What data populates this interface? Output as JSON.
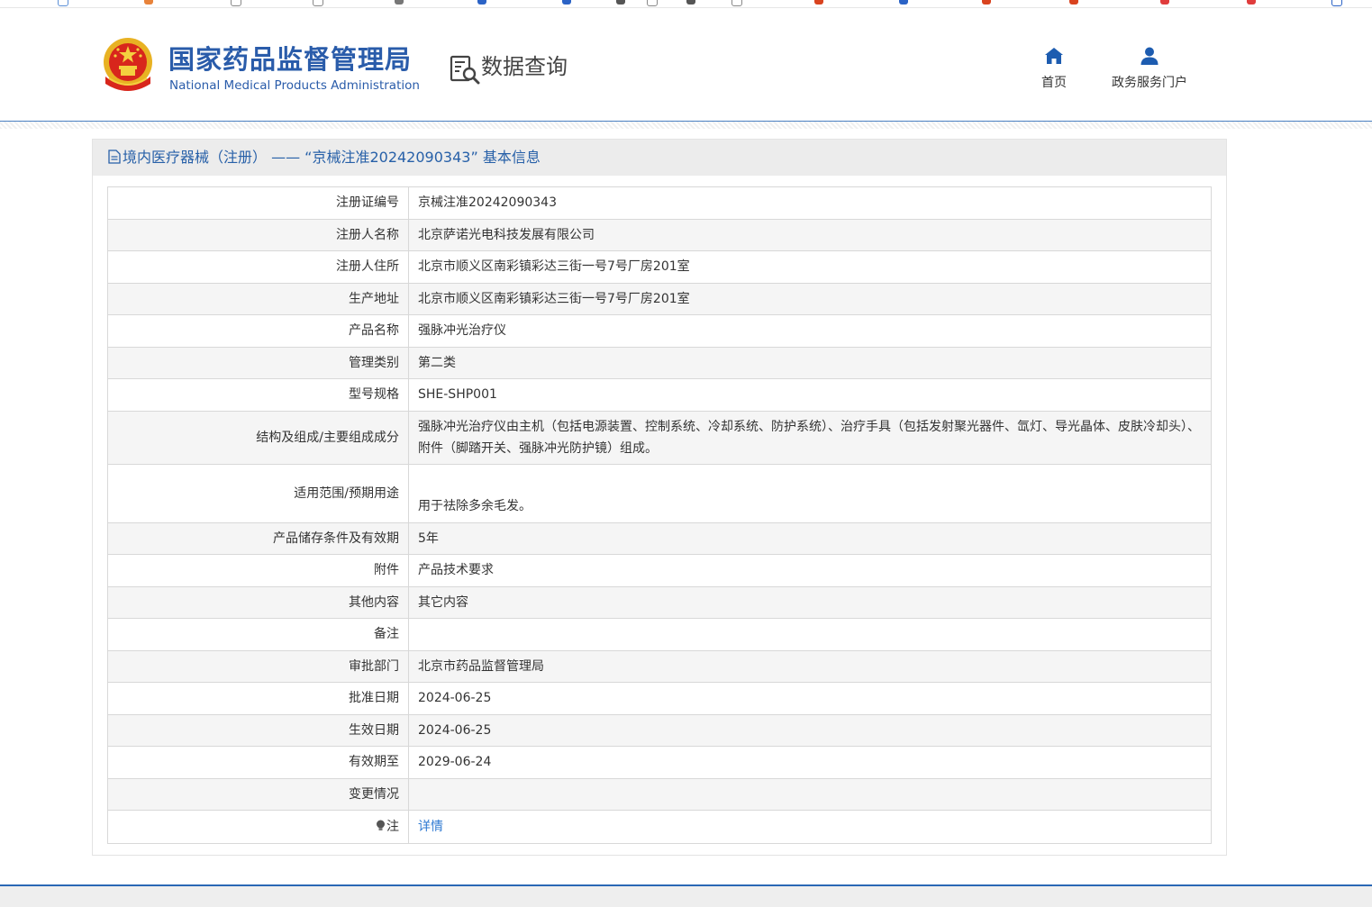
{
  "header": {
    "agency_name_cn": "国家药品监督管理局",
    "agency_name_en": "National Medical Products Administration",
    "section_title": "数据查询",
    "nav": [
      {
        "label": "首页",
        "icon": "home-icon"
      },
      {
        "label": "政务服务门户",
        "icon": "user-icon"
      }
    ]
  },
  "panel": {
    "title": "境内医疗器械（注册） —— “京械注准20242090343” 基本信息"
  },
  "record": [
    {
      "label": "注册证编号",
      "value": "京械注准20242090343"
    },
    {
      "label": "注册人名称",
      "value": "北京萨诺光电科技发展有限公司"
    },
    {
      "label": "注册人住所",
      "value": "北京市顺义区南彩镇彩达三街一号7号厂房201室"
    },
    {
      "label": "生产地址",
      "value": "北京市顺义区南彩镇彩达三街一号7号厂房201室"
    },
    {
      "label": "产品名称",
      "value": "强脉冲光治疗仪"
    },
    {
      "label": "管理类别",
      "value": "第二类"
    },
    {
      "label": "型号规格",
      "value": "SHE-SHP001"
    },
    {
      "label": "结构及组成/主要组成成分",
      "value": "强脉冲光治疗仪由主机（包括电源装置、控制系统、冷却系统、防护系统）、治疗手具（包括发射聚光器件、氙灯、导光晶体、皮肤冷却头）、附件（脚踏开关、强脉冲光防护镜）组成。"
    },
    {
      "label": "适用范围/预期用途",
      "value": "用于祛除多余毛发。"
    },
    {
      "label": "产品储存条件及有效期",
      "value": "5年"
    },
    {
      "label": "附件",
      "value": "产品技术要求"
    },
    {
      "label": "其他内容",
      "value": "其它内容"
    },
    {
      "label": "备注",
      "value": ""
    },
    {
      "label": "审批部门",
      "value": "北京市药品监督管理局"
    },
    {
      "label": "批准日期",
      "value": "2024-06-25"
    },
    {
      "label": "生效日期",
      "value": "2024-06-25"
    },
    {
      "label": "有效期至",
      "value": "2029-06-24"
    },
    {
      "label": "变更情况",
      "value": ""
    }
  ],
  "note": {
    "label": "注",
    "link_text": "详情",
    "icon": "lightbulb-icon"
  },
  "colors": {
    "brand_blue": "#2a5caa",
    "link_blue": "#2f7ad2",
    "header_bar": "#ececec"
  }
}
